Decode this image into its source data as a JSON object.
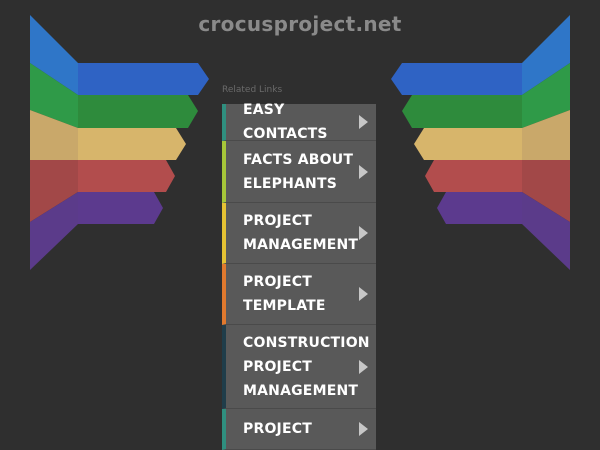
{
  "site": {
    "title": "crocusproject.net"
  },
  "related": {
    "label": "Related Links"
  },
  "menu": {
    "items": [
      {
        "label": "EASY CONTACTS"
      },
      {
        "label": "FACTS ABOUT\nELEPHANTS"
      },
      {
        "label": "PROJECT\nMANAGEMENT"
      },
      {
        "label": "PROJECT\nTEMPLATE"
      },
      {
        "label": "CONSTRUCTION\nPROJECT\nMANAGEMENT"
      },
      {
        "label": "PROJECT"
      }
    ]
  },
  "icons": {
    "menu_arrow": "play-triangle-icon"
  },
  "colors": {
    "background": "#2f2f2f",
    "blue": "#2f63c4",
    "green": "#2e8b3c",
    "gold": "#d7b56b",
    "red": "#b24d4d",
    "purple": "#5c3a8e"
  }
}
